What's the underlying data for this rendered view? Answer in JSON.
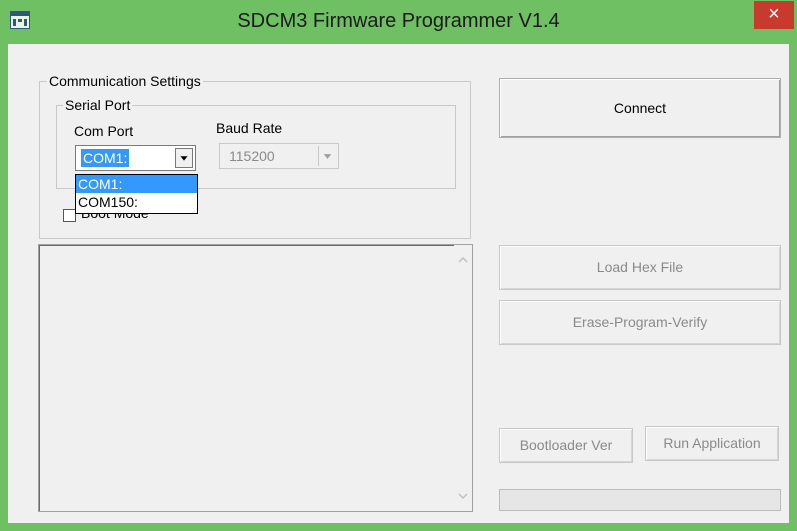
{
  "window": {
    "title": "SDCM3 Firmware Programmer V1.4",
    "close_glyph": "×",
    "colors": {
      "titlebar": "#6fbf63",
      "close": "#c8392e",
      "selection": "#3399ff"
    }
  },
  "communication": {
    "group_label": "Communication Settings",
    "serial_port": {
      "group_label": "Serial Port",
      "com_port_label": "Com Port",
      "com_port_value": "COM1:",
      "com_port_options": [
        "COM1:",
        "COM150:"
      ],
      "baud_rate_label": "Baud Rate",
      "baud_rate_value": "115200"
    },
    "boot_mode_label": "Boot Mode"
  },
  "buttons": {
    "connect": "Connect",
    "load_hex": "Load Hex File",
    "erase_program_verify": "Erase-Program-Verify",
    "bootloader_ver": "Bootloader Ver",
    "run_application": "Run Application"
  },
  "log": {
    "text": ""
  },
  "progress": {
    "value": 0
  },
  "icons": {
    "app": "app-window-icon",
    "close": "close-icon",
    "dropdown": "chevron-down-icon",
    "scroll_up": "scroll-up-icon",
    "scroll_down": "scroll-down-icon"
  }
}
